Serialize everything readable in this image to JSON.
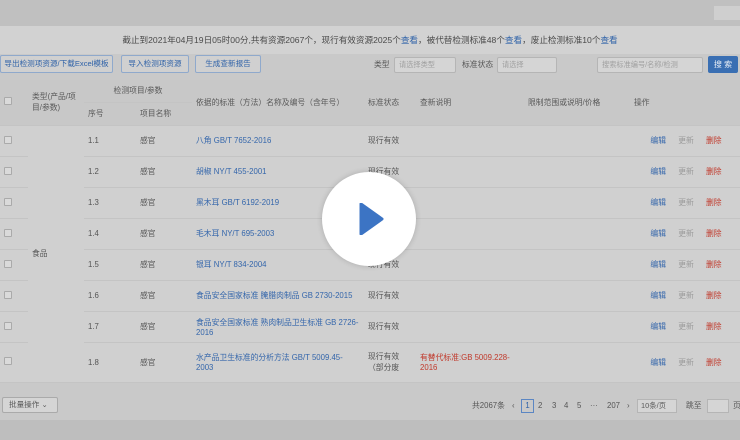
{
  "notice": {
    "prefix": "截止到2021年04月19日05时00分,共有资源2067个，现行有效资源2025个",
    "view1": "查看",
    "mid": "，被代替检测标准48个",
    "view2": "查看",
    "mid2": "，废止检测标准10个",
    "view3": "查看"
  },
  "toolbar": {
    "export_label": "导出检测项资源/下载Excel模板",
    "import_label": "导入检测项资源",
    "report_label": "生成查新报告",
    "type_label": "类型",
    "type_placeholder": "请选择类型",
    "status_label": "标准状态",
    "status_placeholder": "请选择",
    "search_placeholder": "搜索标准编号/名称/检测",
    "search_button": "搜 索"
  },
  "table": {
    "headers": {
      "category": "类型(产品/项目/参数)",
      "group": "检测项目/参数",
      "seq": "序号",
      "item": "项目名称",
      "standard": "依据的标准（方法）名称及编号（含年号）",
      "status": "标准状态",
      "note": "查新说明",
      "limit": "限制范围或说明/价格",
      "ops": "操作"
    },
    "category_value": "食品",
    "rows": [
      {
        "seq": "1.1",
        "item": "感官",
        "standard": "八角  GB/T 7652-2016",
        "status": "现行有效",
        "note": ""
      },
      {
        "seq": "1.2",
        "item": "感官",
        "standard": "胡椒  NY/T 455-2001",
        "status": "现行有效",
        "note": ""
      },
      {
        "seq": "1.3",
        "item": "感官",
        "standard": "黑木耳  GB/T 6192-2019",
        "status": "现行有效",
        "note": ""
      },
      {
        "seq": "1.4",
        "item": "感官",
        "standard": "毛木耳  NY/T 695-2003",
        "status": "现行有效",
        "note": ""
      },
      {
        "seq": "1.5",
        "item": "感官",
        "standard": "银耳  NY/T 834-2004",
        "status": "现行有效",
        "note": ""
      },
      {
        "seq": "1.6",
        "item": "感官",
        "standard": "食品安全国家标准 腌腊肉制品  GB 2730-2015",
        "status": "现行有效",
        "note": ""
      },
      {
        "seq": "1.7",
        "item": "感官",
        "standard": "食品安全国家标准 熟肉制品卫生标准  GB 2726-2016",
        "status": "现行有效",
        "note": ""
      },
      {
        "seq": "1.8",
        "item": "感官",
        "standard": "水产品卫生标准的分析方法 GB/T 5009.45-2003",
        "status": "现行有效（部分废",
        "note": "有替代标准:GB 5009.228-2016"
      }
    ],
    "ops": {
      "edit": "编辑",
      "update": "更新",
      "delete": "删除"
    }
  },
  "pager": {
    "bulk": "批量操作",
    "total": "共2067条",
    "prev": "‹",
    "current": "1",
    "pages": [
      "2",
      "3",
      "4",
      "5"
    ],
    "ellipsis": "···",
    "last": "207",
    "next": "›",
    "size": "10条/页",
    "jump_label": "跳至",
    "page_suffix": "页"
  },
  "overlay": {
    "icon": "play-icon",
    "color": "#3c74c4"
  }
}
